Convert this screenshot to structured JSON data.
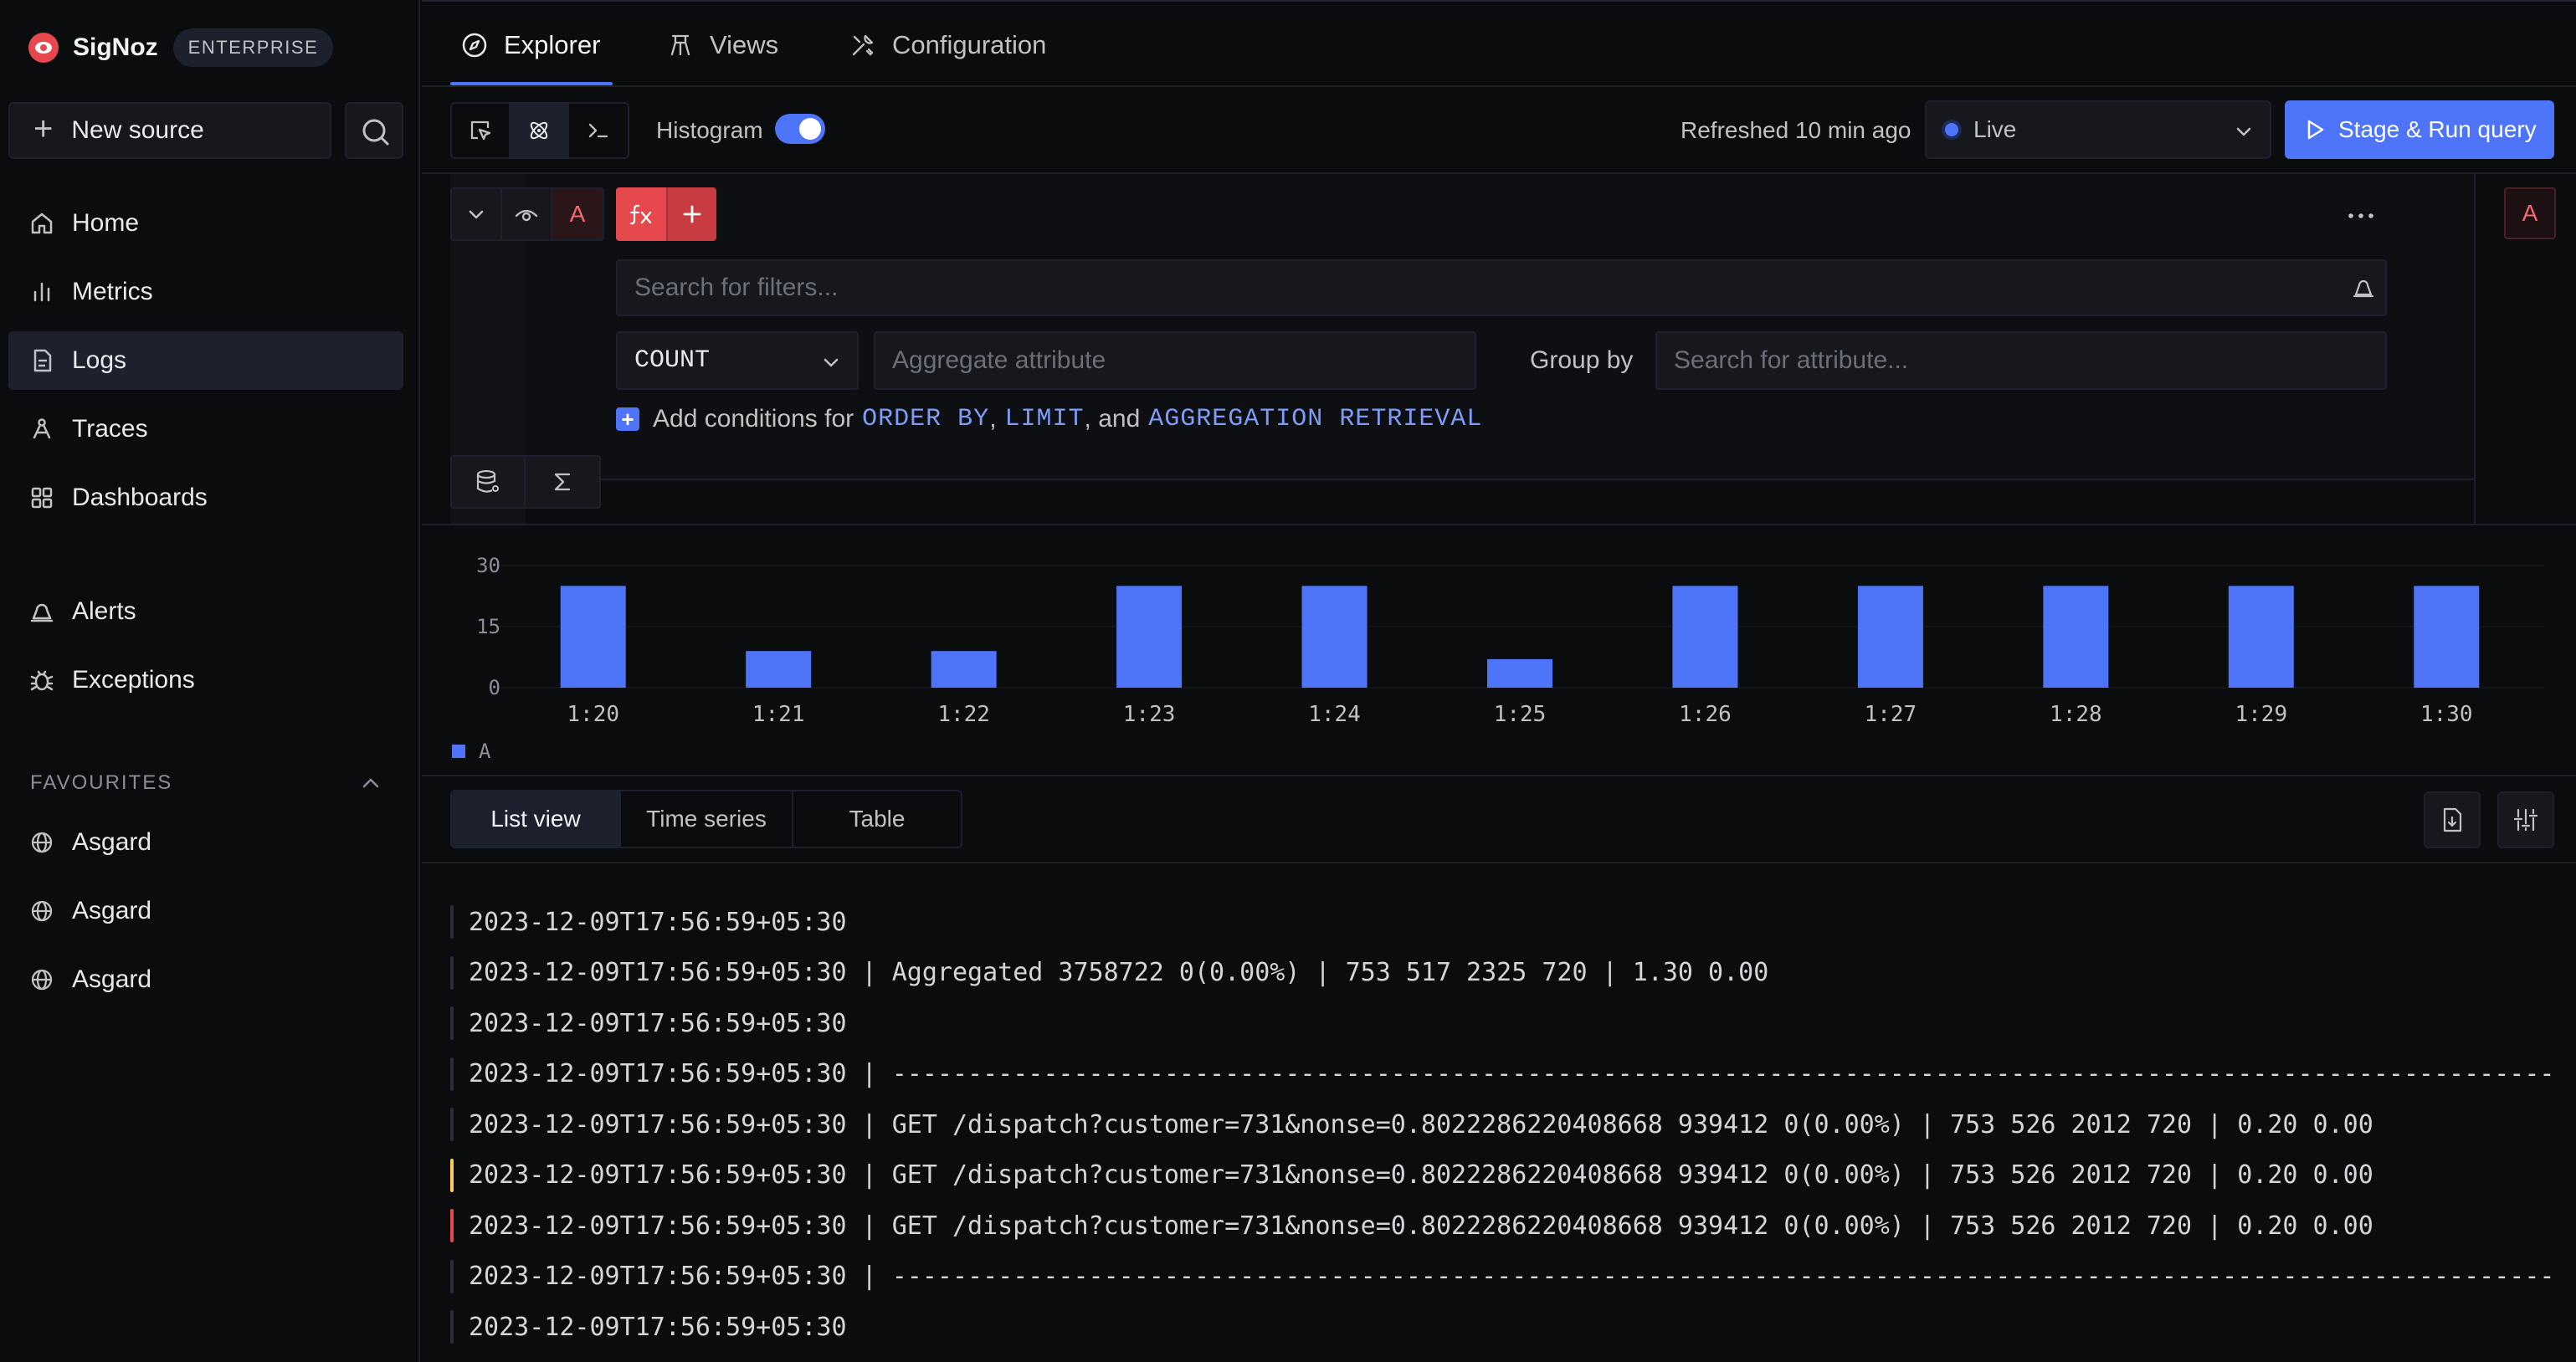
{
  "brand": {
    "name": "SigNoz",
    "badge": "ENTERPRISE"
  },
  "sidebar": {
    "new_source": "New source",
    "nav": [
      {
        "label": "Home",
        "icon": "home-icon"
      },
      {
        "label": "Metrics",
        "icon": "bar-chart-icon"
      },
      {
        "label": "Logs",
        "icon": "logs-icon",
        "active": true
      },
      {
        "label": "Traces",
        "icon": "traces-icon"
      },
      {
        "label": "Dashboards",
        "icon": "dashboards-icon"
      },
      {
        "label": "Alerts",
        "icon": "alert-bell-icon"
      },
      {
        "label": "Exceptions",
        "icon": "bug-icon"
      }
    ],
    "favourites_label": "FAVOURITES",
    "favourites": [
      {
        "label": "Asgard"
      },
      {
        "label": "Asgard"
      },
      {
        "label": "Asgard"
      }
    ]
  },
  "tabs": [
    {
      "label": "Explorer",
      "icon": "compass-icon",
      "active": true
    },
    {
      "label": "Views",
      "icon": "views-icon"
    },
    {
      "label": "Configuration",
      "icon": "tools-icon"
    }
  ],
  "toolbar": {
    "histogram_label": "Histogram",
    "histogram_on": true,
    "refreshed": "Refreshed 10 min ago",
    "live_label": "Live",
    "run_label": "Stage & Run query"
  },
  "query": {
    "name": "A",
    "filter_placeholder": "Search for filters...",
    "aggregate_op": "COUNT",
    "aggregate_placeholder": "Aggregate attribute",
    "group_by_label": "Group by",
    "group_by_placeholder": "Search for attribute...",
    "add_conditions": {
      "prefix": "Add conditions for",
      "order_by": "ORDER BY",
      "comma": ",",
      "limit": "LIMIT",
      "and": ", and",
      "aggregation": "AGGREGATION RETRIEVAL"
    }
  },
  "chart_data": {
    "type": "bar",
    "categories": [
      "1:20",
      "1:21",
      "1:22",
      "1:23",
      "1:24",
      "1:25",
      "1:26",
      "1:27",
      "1:28",
      "1:29",
      "1:30"
    ],
    "series": [
      {
        "name": "A",
        "values": [
          25,
          9,
          9,
          25,
          25,
          7,
          25,
          25,
          25,
          25,
          25
        ],
        "color": "#4e74f8"
      }
    ],
    "yticks": [
      30,
      15,
      0
    ],
    "ylim": [
      0,
      30
    ],
    "legend_position": "bottom-left"
  },
  "views": {
    "tabs": [
      {
        "label": "List view",
        "active": true
      },
      {
        "label": "Time series"
      },
      {
        "label": "Table"
      }
    ]
  },
  "logs": [
    {
      "text": "2023-12-09T17:56:59+05:30",
      "level": "info"
    },
    {
      "text": "2023-12-09T17:56:59+05:30 | Aggregated 3758722 0(0.00%) | 753 517 2325 720 | 1.30 0.00",
      "level": "info"
    },
    {
      "text": "2023-12-09T17:56:59+05:30",
      "level": "info"
    },
    {
      "text": "2023-12-09T17:56:59+05:30 | --------------------------------------------------------------------------------------------------------------",
      "level": "info"
    },
    {
      "text": "2023-12-09T17:56:59+05:30 | GET /dispatch?customer=731&nonse=0.8022286220408668 939412 0(0.00%) | 753 526 2012 720 | 0.20 0.00",
      "level": "info"
    },
    {
      "text": "2023-12-09T17:56:59+05:30 | GET /dispatch?customer=731&nonse=0.8022286220408668 939412 0(0.00%) | 753 526 2012 720 | 0.20 0.00",
      "level": "warn"
    },
    {
      "text": "2023-12-09T17:56:59+05:30 | GET /dispatch?customer=731&nonse=0.8022286220408668 939412 0(0.00%) | 753 526 2012 720 | 0.20 0.00",
      "level": "error"
    },
    {
      "text": "2023-12-09T17:56:59+05:30 | --------------------------------------------------------------------------------------------------------------",
      "level": "info"
    },
    {
      "text": "2023-12-09T17:56:59+05:30",
      "level": "info"
    }
  ]
}
